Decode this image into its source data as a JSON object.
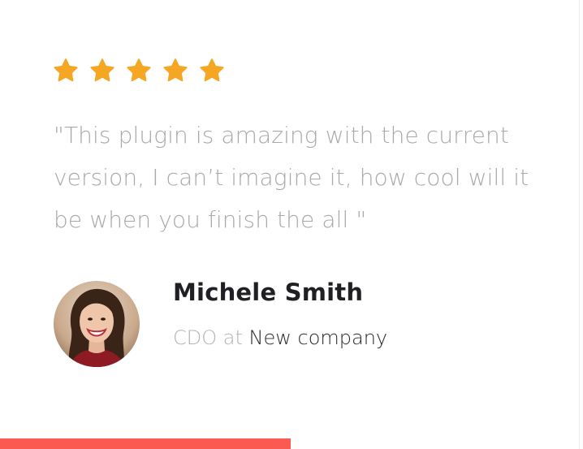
{
  "testimonial": {
    "rating": {
      "value": 5,
      "max": 5,
      "color": "#f5a623",
      "icon": "star-icon"
    },
    "quote": "\"This plugin is amazing with the current version, I can’t imagine it, how cool will it be when you finish the all \"",
    "author": {
      "name": "Michele Smith",
      "role": "CDO",
      "connector": "at",
      "company": "New company"
    }
  },
  "colors": {
    "accent_bar": "#fa5a50",
    "quote_text": "#a9a9a9",
    "name_text": "#1f1f24"
  }
}
